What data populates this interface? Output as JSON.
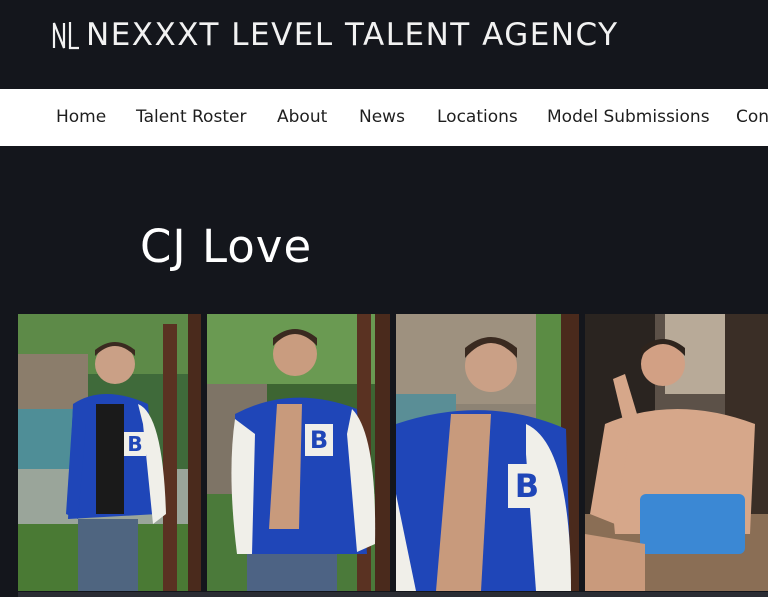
{
  "header": {
    "logo_text": "NL",
    "site_title": "NEXXXT LEVEL TALENT AGENCY"
  },
  "nav": {
    "items": [
      {
        "label": "Home"
      },
      {
        "label": "Talent Roster"
      },
      {
        "label": "About"
      },
      {
        "label": "News"
      },
      {
        "label": "Locations"
      },
      {
        "label": "Model Submissions"
      },
      {
        "label": "Con"
      }
    ]
  },
  "main": {
    "page_title": "CJ Love"
  },
  "gallery": {
    "photos": [
      {
        "name": "photo-1",
        "jacket_letter": "B"
      },
      {
        "name": "photo-2",
        "jacket_letter": "B"
      },
      {
        "name": "photo-3",
        "jacket_letter": "B"
      },
      {
        "name": "photo-4"
      }
    ]
  },
  "colors": {
    "background": "#14161c",
    "nav_background": "#ffffff",
    "jacket_blue": "#1f46b8",
    "jacket_white": "#f0efe9"
  }
}
